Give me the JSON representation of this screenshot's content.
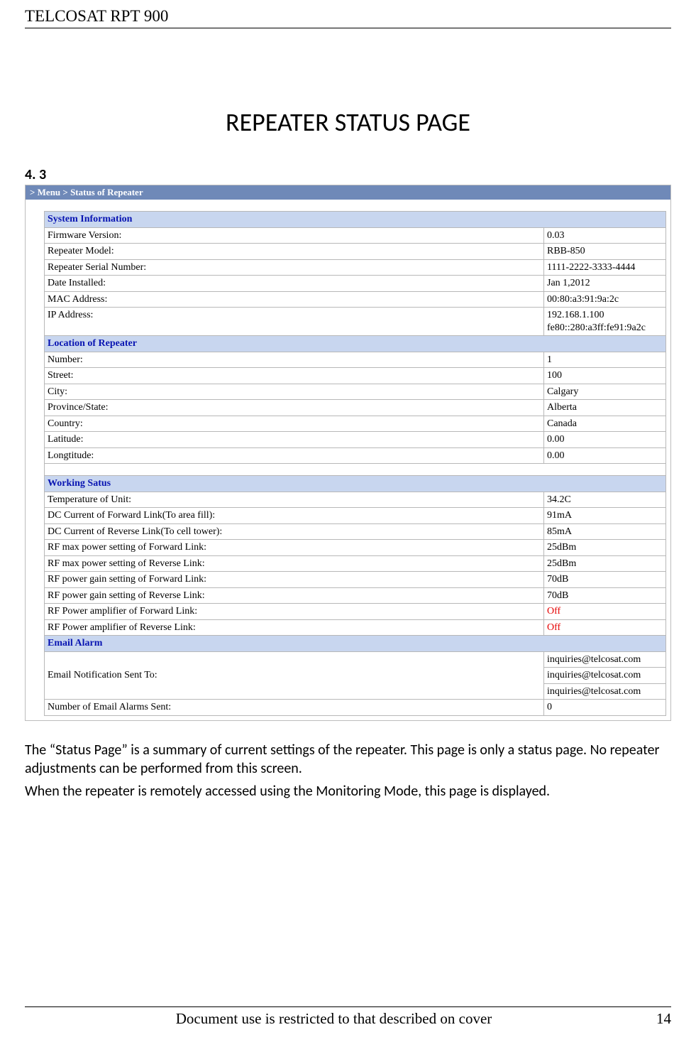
{
  "doc": {
    "header": "TELCOSAT RPT 900",
    "title": "REPEATER STATUS PAGE",
    "section_number": "4. 3",
    "footer_text": "Document use is restricted to that described on cover",
    "page_number": "14"
  },
  "screenshot": {
    "breadcrumb": "> Menu > Status of Repeater",
    "sections": {
      "sysinfo_title": "System Information",
      "location_title": "Location of Repeater",
      "working_title": "Working Satus",
      "email_title": "Email Alarm"
    },
    "sysinfo": {
      "firmware_label": "Firmware Version:",
      "firmware_value": "0.03",
      "model_label": "Repeater Model:",
      "model_value": "RBB-850",
      "serial_label": "Repeater Serial Number:",
      "serial_value": "1111-2222-3333-4444",
      "date_label": "Date Installed:",
      "date_value": "Jan 1,2012",
      "mac_label": "MAC Address:",
      "mac_value": "00:80:a3:91:9a:2c",
      "ip_label": "IP Address:",
      "ip_value": "192.168.1.100\nfe80::280:a3ff:fe91:9a2c"
    },
    "location": {
      "number_label": "Number:",
      "number_value": "1",
      "street_label": "Street:",
      "street_value": "100",
      "city_label": "City:",
      "city_value": "Calgary",
      "province_label": "Province/State:",
      "province_value": "Alberta",
      "country_label": "Country:",
      "country_value": "Canada",
      "lat_label": "Latitude:",
      "lat_value": "0.00",
      "long_label": "Longtitude:",
      "long_value": "0.00"
    },
    "working": {
      "temp_label": "Temperature of Unit:",
      "temp_value": "34.2C",
      "dcf_label": "DC Current of Forward Link(To area fill):",
      "dcf_value": "91mA",
      "dcr_label": "DC Current of Reverse Link(To cell tower):",
      "dcr_value": "85mA",
      "rfpf_label": "RF max power setting of Forward Link:",
      "rfpf_value": "25dBm",
      "rfpr_label": "RF max power setting of Reverse Link:",
      "rfpr_value": "25dBm",
      "rfgf_label": "RF power gain setting of Forward Link:",
      "rfgf_value": "70dB",
      "rfgr_label": "RF power gain setting of Reverse Link:",
      "rfgr_value": "70dB",
      "ampf_label": "RF Power amplifier of Forward Link:",
      "ampf_value": "Off",
      "ampr_label": "RF Power amplifier of Reverse Link:",
      "ampr_value": "Off"
    },
    "email": {
      "sent_to_label": "Email Notification Sent To:",
      "addr1": "inquiries@telcosat.com",
      "addr2": "inquiries@telcosat.com",
      "addr3": "inquiries@telcosat.com",
      "count_label": "Number of Email Alarms Sent:",
      "count_value": "0"
    }
  },
  "body": {
    "p1": "The “Status Page” is a summary of current settings of the repeater. This page is only a status page. No repeater adjustments can be performed from this screen.",
    "p2": "When the repeater is remotely accessed using the Monitoring Mode, this page is displayed."
  }
}
